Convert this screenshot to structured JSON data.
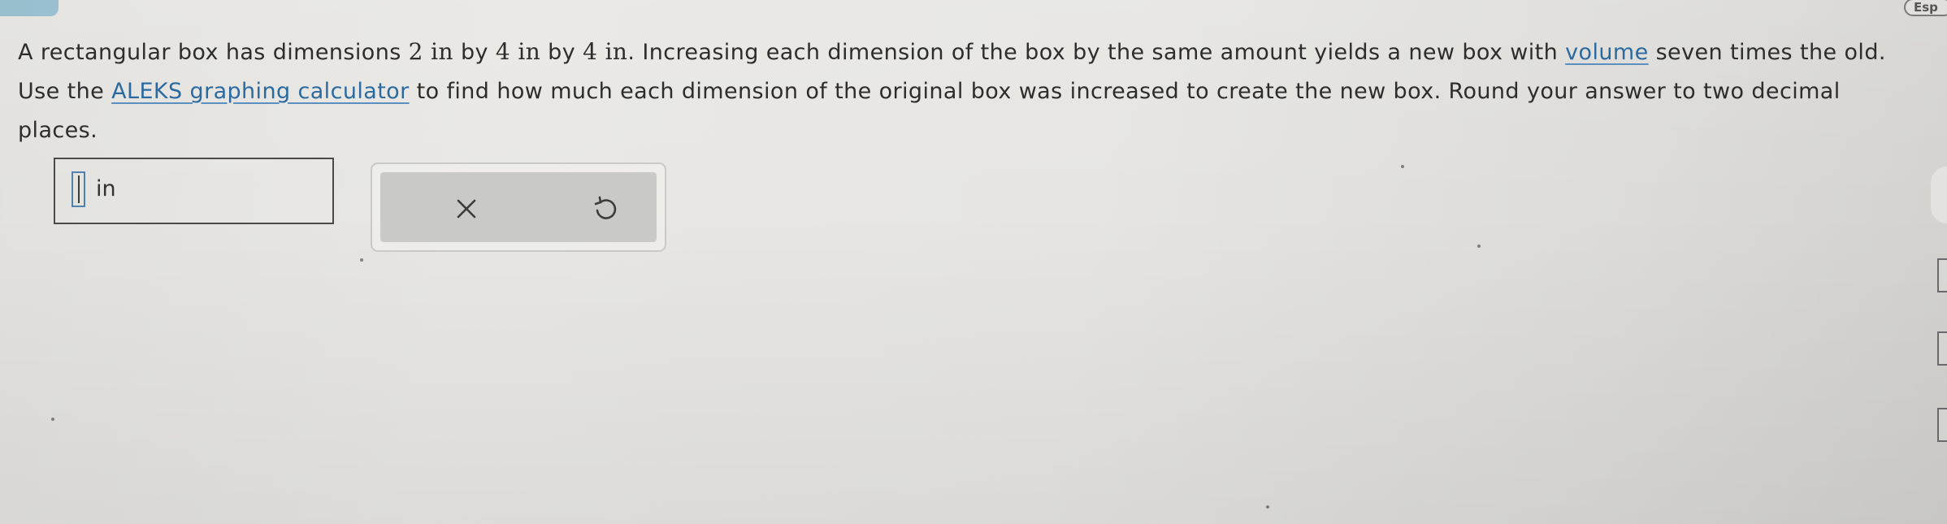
{
  "question": {
    "part1": "A rectangular box has dimensions ",
    "dim1": "2 in",
    "by1": " by ",
    "dim2": "4 in",
    "by2": " by ",
    "dim3": "4 in",
    "part2": ". Increasing each dimension of the box by the same amount yields a new box with ",
    "volume_link": "volume",
    "part3": " seven times the old. Use the ",
    "calculator_link": "ALEKS graphing calculator",
    "part4": " to find how much each dimension of the original box was increased to create the new box. Round your answer to two decimal places."
  },
  "answer": {
    "value": "",
    "unit": "in"
  },
  "actions": {
    "clear_symbol": "×",
    "undo_symbol": "↺"
  },
  "edge": {
    "language_label": "Esp"
  },
  "icons": {
    "clear": "close-icon",
    "undo": "undo-icon"
  },
  "colors": {
    "link": "#2b6aa0",
    "input_border": "#4f83ae",
    "action_panel": "#c9cac8"
  }
}
